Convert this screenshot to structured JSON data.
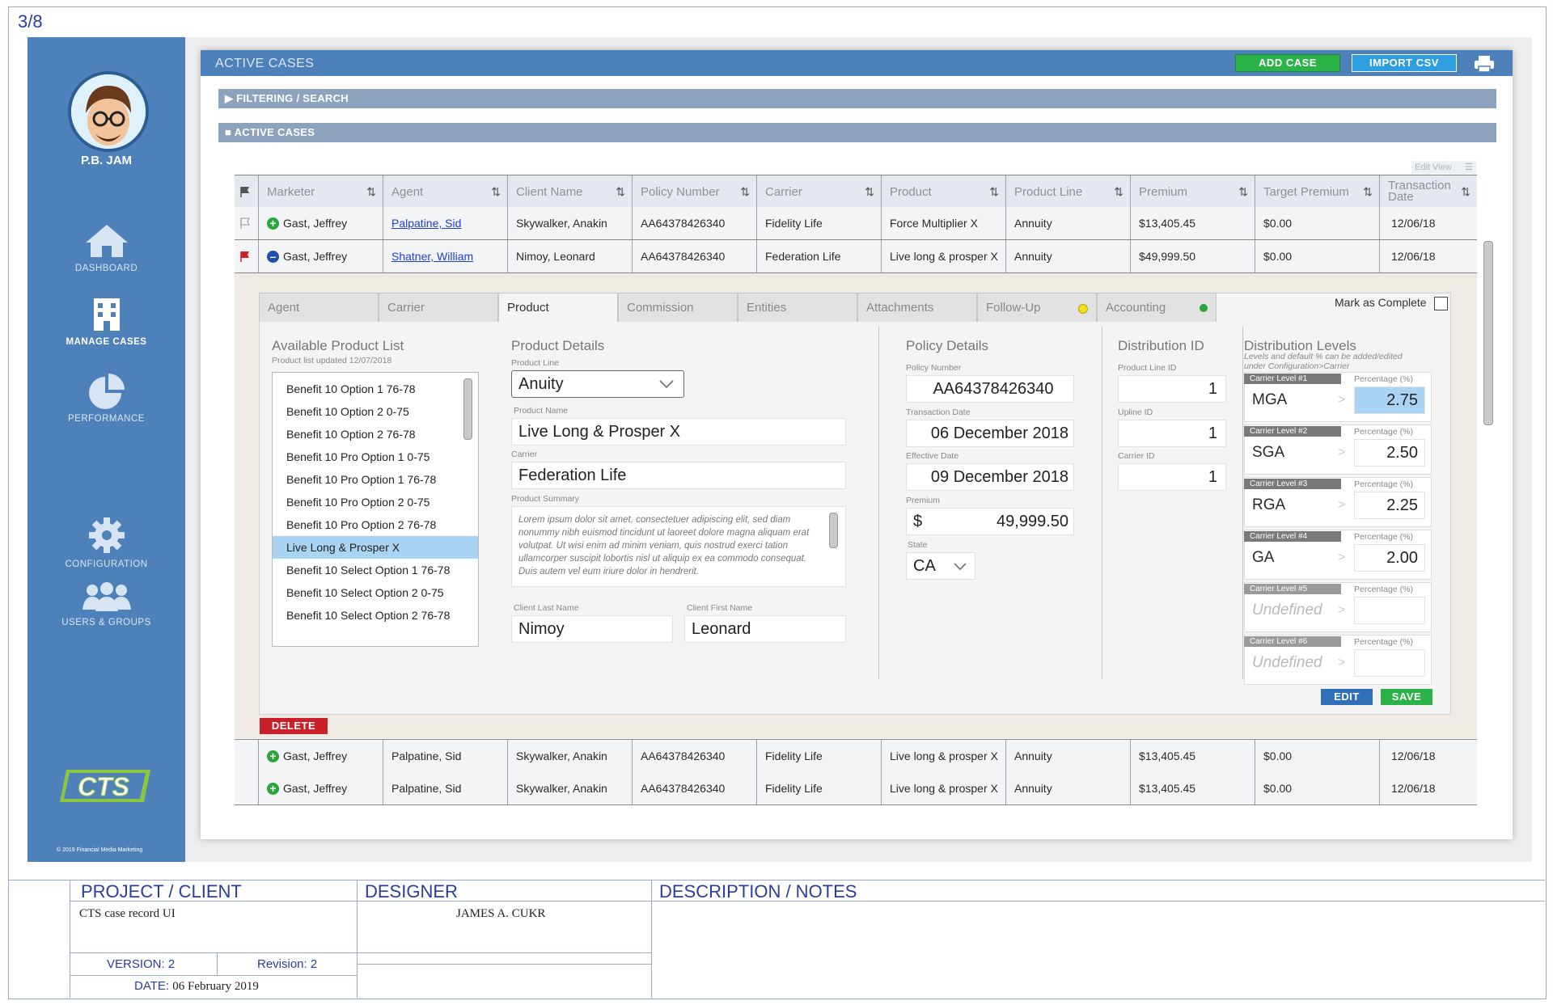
{
  "page_number": "3/8",
  "user": {
    "name": "P.B. JAM"
  },
  "nav": [
    {
      "label": "DASHBOARD",
      "icon": "home-icon"
    },
    {
      "label": "MANAGE CASES",
      "icon": "building-icon"
    },
    {
      "label": "PERFORMANCE",
      "icon": "pie-chart-icon"
    },
    {
      "label": "CONFIGURATION",
      "icon": "gear-icon"
    },
    {
      "label": "USERS & GROUPS",
      "icon": "users-icon"
    }
  ],
  "copyright": "© 2019 Financial Media Marketing",
  "header": {
    "title": "ACTIVE CASES",
    "add_case": "ADD CASE",
    "import_csv": "IMPORT CSV",
    "add_color": "#2bb34a",
    "import_color": "#2e9ede"
  },
  "sections": {
    "filtering": "▶ FILTERING / SEARCH",
    "active": "■ ACTIVE CASES"
  },
  "edit_view": "Edit View",
  "columns": [
    "Marketer",
    "Agent",
    "Client Name",
    "Policy Number",
    "Carrier",
    "Product",
    "Product Line",
    "Premium",
    "Target Premium",
    "Transaction Date"
  ],
  "rows": [
    {
      "marketer": "Gast, Jeffrey",
      "agent": "Palpatine, Sid",
      "client": "Skywalker, Anakin",
      "policy": "AA64378426340",
      "carrier": "Fidelity Life",
      "product": "Force Multiplier X",
      "line": "Annuity",
      "premium": "$13,405.45",
      "target": "$0.00",
      "date": "12/06/18"
    },
    {
      "marketer": "Gast, Jeffrey",
      "agent": "Shatner, William",
      "client": "Nimoy, Leonard",
      "policy": "AA64378426340",
      "carrier": "Federation Life",
      "product": "Live long & prosper X",
      "line": "Annuity",
      "premium": "$49,999.50",
      "target": "$0.00",
      "date": "12/06/18"
    },
    {
      "marketer": "Gast, Jeffrey",
      "agent": "Palpatine, Sid",
      "client": "Skywalker, Anakin",
      "policy": "AA64378426340",
      "carrier": "Fidelity Life",
      "product": "Live long & prosper X",
      "line": "Annuity",
      "premium": "$13,405.45",
      "target": "$0.00",
      "date": "12/06/18"
    },
    {
      "marketer": "Gast, Jeffrey",
      "agent": "Palpatine, Sid",
      "client": "Skywalker, Anakin",
      "policy": "AA64378426340",
      "carrier": "Fidelity Life",
      "product": "Live long & prosper X",
      "line": "Annuity",
      "premium": "$13,405.45",
      "target": "$0.00",
      "date": "12/06/18"
    }
  ],
  "tabs": [
    "Agent",
    "Carrier",
    "Product",
    "Commission",
    "Entities",
    "Attachments",
    "Follow-Up",
    "Accounting"
  ],
  "mark_complete": "Mark as Complete",
  "product_list": {
    "title": "Available Product List",
    "updated": "Product list updated 12/07/2018",
    "items": [
      "Benefit 10 Option 1 76-78",
      "Benefit 10 Option 2 0-75",
      "Benefit 10 Option 2 76-78",
      "Benefit 10 Pro Option 1 0-75",
      "Benefit 10 Pro Option 1 76-78",
      "Benefit 10 Pro Option 2 0-75",
      "Benefit 10 Pro Option 2 76-78",
      "Live Long & Prosper X",
      "Benefit 10 Select Option 1 76-78",
      "Benefit 10 Select Option 2 0-75",
      "Benefit 10 Select Option 2 76-78"
    ]
  },
  "product_details": {
    "title": "Product Details",
    "line_label": "Product Line",
    "line": "Anuity",
    "name_label": "Product Name",
    "name": "Live Long & Prosper X",
    "carrier_label": "Carrier",
    "carrier": "Federation Life",
    "summary_label": "Product Summary",
    "summary": "Lorem ipsum dolor sit amet, consectetuer adipiscing elit, sed diam nonummy nibh euismod tincidunt ut laoreet dolore magna aliquam erat volutpat. Ut wisi enim ad minim veniam, quis nostrud exerci tation ullamcorper suscipit lobortis nisl ut aliquip ex ea commodo consequat. Duis autem vel eum iriure dolor in hendrerit.",
    "last_label": "Client Last Name",
    "last": "Nimoy",
    "first_label": "Client First Name",
    "first": "Leonard"
  },
  "policy_details": {
    "title": "Policy Details",
    "number_label": "Policy Number",
    "number": "AA64378426340",
    "trans_label": "Transaction Date",
    "trans": "06 December 2018",
    "eff_label": "Effective Date",
    "eff": "09 December 2018",
    "premium_label": "Premium",
    "currency": "$",
    "premium": "49,999.50",
    "state_label": "State",
    "state": "CA"
  },
  "distribution_id": {
    "title": "Distribution ID",
    "fields": [
      {
        "label": "Product Line ID",
        "value": "1"
      },
      {
        "label": "Upline ID",
        "value": "1"
      },
      {
        "label": "Carrier ID",
        "value": "1"
      }
    ]
  },
  "distribution_levels": {
    "title": "Distribution Levels",
    "note1": "Levels and default % can be added/edited",
    "note2": "under Configuration>Carrier",
    "pct_label": "Percentage (%)",
    "levels": [
      {
        "label": "Carrier Level #1",
        "name": "MGA",
        "pct": "2.75"
      },
      {
        "label": "Carrier Level #2",
        "name": "SGA",
        "pct": "2.50"
      },
      {
        "label": "Carrier Level #3",
        "name": "RGA",
        "pct": "2.25"
      },
      {
        "label": "Carrier Level #4",
        "name": "GA",
        "pct": "2.00"
      },
      {
        "label": "Carrier Level #5",
        "name": "Undefined",
        "pct": ""
      },
      {
        "label": "Carrier Level #6",
        "name": "Undefined",
        "pct": ""
      }
    ],
    "edit": "EDIT",
    "save": "SAVE"
  },
  "delete": "DELETE",
  "title_block": {
    "project_h": "PROJECT / CLIENT",
    "project": "CTS case record UI",
    "designer_h": "DESIGNER",
    "designer": "JAMES A. CUKR",
    "notes_h": "DESCRIPTION / NOTES",
    "version_label": "VERSION:",
    "version": "2",
    "revision_label": "Revision:",
    "revision": "2",
    "date_label": "DATE:",
    "date": "06 February 2019"
  }
}
